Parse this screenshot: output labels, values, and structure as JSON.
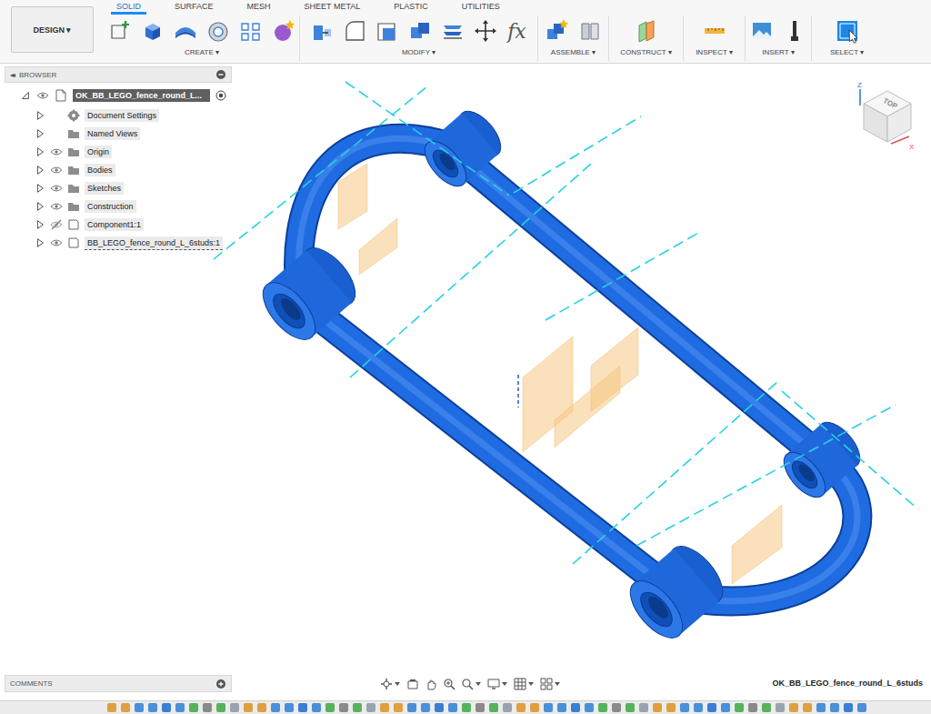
{
  "workspace": {
    "label": "DESIGN ▾"
  },
  "tabs": [
    {
      "label": "SOLID",
      "selected": true
    },
    {
      "label": "SURFACE",
      "selected": false
    },
    {
      "label": "MESH",
      "selected": false
    },
    {
      "label": "SHEET METAL",
      "selected": false
    },
    {
      "label": "PLASTIC",
      "selected": false
    },
    {
      "label": "UTILITIES",
      "selected": false
    }
  ],
  "tool_groups": [
    {
      "label": "CREATE ▾"
    },
    {
      "label": "MODIFY ▾",
      "glyph": "fx"
    },
    {
      "label": "ASSEMBLE ▾"
    },
    {
      "label": "CONSTRUCT ▾"
    },
    {
      "label": "INSPECT ▾"
    },
    {
      "label": "INSERT ▾"
    },
    {
      "label": "SELECT ▾"
    }
  ],
  "browser": {
    "title": "BROWSER",
    "collapse_glyph": "◂◂",
    "items": [
      {
        "label": "OK_BB_LEGO_fence_round_L...",
        "kind": "root",
        "expanded": true,
        "eye": true,
        "visible": true,
        "selected": true,
        "linked": false,
        "active": true
      },
      {
        "label": "Document Settings",
        "kind": "settings",
        "expanded": false,
        "eye": false,
        "visible": true,
        "selected": false,
        "linked": false,
        "active": false
      },
      {
        "label": "Named Views",
        "kind": "folder",
        "expanded": false,
        "eye": false,
        "visible": true,
        "selected": false,
        "linked": false,
        "active": false
      },
      {
        "label": "Origin",
        "kind": "folder",
        "expanded": false,
        "eye": true,
        "visible": true,
        "selected": false,
        "linked": false,
        "active": false
      },
      {
        "label": "Bodies",
        "kind": "folder",
        "expanded": false,
        "eye": true,
        "visible": true,
        "selected": false,
        "linked": false,
        "active": false
      },
      {
        "label": "Sketches",
        "kind": "folder",
        "expanded": false,
        "eye": true,
        "visible": true,
        "selected": false,
        "linked": false,
        "active": false
      },
      {
        "label": "Construction",
        "kind": "folder",
        "expanded": false,
        "eye": true,
        "visible": true,
        "selected": false,
        "linked": false,
        "active": false
      },
      {
        "label": "Component1:1",
        "kind": "component",
        "expanded": false,
        "eye": true,
        "visible": false,
        "selected": false,
        "linked": false,
        "active": false
      },
      {
        "label": "BB_LEGO_fence_round_L_6studs:1",
        "kind": "component",
        "expanded": false,
        "eye": true,
        "visible": true,
        "selected": false,
        "linked": true,
        "active": false
      }
    ]
  },
  "viewcube": {
    "face": "TOP",
    "axes": [
      {
        "label": "Z",
        "color": "#2d6fd6"
      },
      {
        "label": "X",
        "color": "#d9534f"
      }
    ]
  },
  "comments": {
    "title": "COMMENTS"
  },
  "document_name": "OK_BB_LEGO_fence_round_L_6studs"
}
